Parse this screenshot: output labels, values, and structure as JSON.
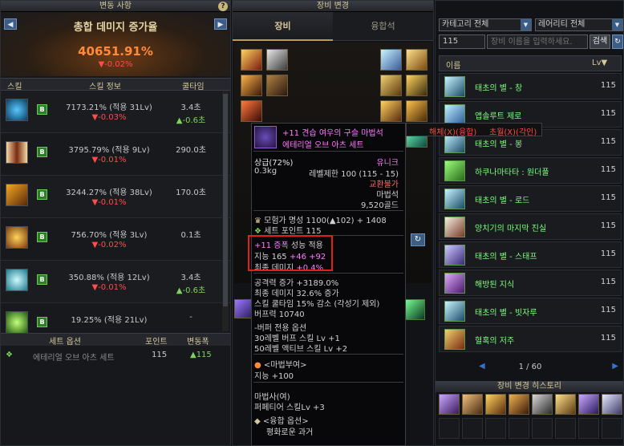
{
  "left": {
    "title": "변동 사항",
    "help": "?",
    "prev": "◀",
    "next": "▶",
    "dmg_title": "총합 데미지 증가율",
    "dmg_value": "40651.91%",
    "dmg_delta": "▼-0.02%",
    "headers": {
      "skill": "스킬",
      "info": "스킬 정보",
      "cooldown": "쿨타임"
    },
    "skills": [
      {
        "badge": "B",
        "info": "7173.21% (적용 31Lv)",
        "delta": "▼-0.03%",
        "cool": "3.4초",
        "cool_delta": "▲-0.6초"
      },
      {
        "badge": "B",
        "info": "3795.79% (적용 9Lv)",
        "delta": "▼-0.01%",
        "cool": "290.0초",
        "cool_delta": ""
      },
      {
        "badge": "B",
        "info": "3244.27% (적용 38Lv)",
        "delta": "▼-0.01%",
        "cool": "170.0초",
        "cool_delta": ""
      },
      {
        "badge": "B",
        "info": "756.70% (적용 3Lv)",
        "delta": "▼-0.02%",
        "cool": "0.1초",
        "cool_delta": ""
      },
      {
        "badge": "B",
        "info": "350.88% (적용 12Lv)",
        "delta": "▼-0.01%",
        "cool": "3.4초",
        "cool_delta": "▲-0.6초"
      },
      {
        "badge": "B",
        "info": "19.25% (적용 21Lv)",
        "delta": "",
        "cool": "-",
        "cool_delta": ""
      }
    ],
    "set_headers": {
      "option": "세트 옵션",
      "point": "포인트",
      "delta": "변동폭"
    },
    "set_row": {
      "name": "에테리얼 오브 아츠 세트",
      "point": "115",
      "delta": "▲115"
    }
  },
  "center": {
    "title": "장비 변경",
    "tab_equip": "장비",
    "tab_fusion": "융합석"
  },
  "tooltip": {
    "name": "+11 견습 여우의 구슬 마법석",
    "set": "에테리얼 오브 아츠 세트",
    "grade": "상급(72%)",
    "rarity": "유니크",
    "weight": "0.3kg",
    "level_limit": "레벨제한 100 (115 - 15)",
    "trade": "교환불가",
    "type": "마법석",
    "price": "9,520골드",
    "fame": "모험가 명성 1100(▲102) + 1408",
    "set_point": "세트 포인트 115",
    "amp_title": "+11 증폭",
    "amp_note": "성능 적용",
    "int": "지능 165",
    "int_add1": "+46",
    "int_add2": "+92",
    "final_dmg": "최종 데미지",
    "final_dmg_val": "+0.4%",
    "stat1": "공격력 증가 +3189.0%",
    "stat2": "최종 데미지 32.6% 증가",
    "stat3": "스킬 쿨타임 15% 감소 (각성기 제외)",
    "stat4": "버프력 10740",
    "buff_title": "-버퍼 전용 옵션",
    "buff1": "30레벨 버프 스킬 Lv +1",
    "buff2": "50레벨 액티브 스킬 Lv +2",
    "enchant_title": "<마법부여>",
    "enchant": "지능 +100",
    "class_title": "마법사(여)",
    "class_skill": "퍼페티어 스킬Lv +3",
    "fusion_title": "<융합 옵션>",
    "fusion": "평화로운 과거"
  },
  "context_menu": {
    "unfuse": "해체(X)(융합)",
    "transcend": "초월(X)(각인)"
  },
  "right": {
    "category": "카테고리 전체",
    "rarity": "레어리티 전체",
    "level": "115",
    "search_placeholder": "장비 이름을 입력하세요.",
    "search_btn": "검색",
    "col_name": "이름",
    "col_lv": "Lv▼",
    "items": [
      {
        "name": "태초의 별 - 창",
        "lv": "115"
      },
      {
        "name": "앱솔루트 제로",
        "lv": "115"
      },
      {
        "name": "태초의 별 - 봉",
        "lv": "115"
      },
      {
        "name": "하쿠나마타타 : 원더풀",
        "lv": "115"
      },
      {
        "name": "태초의 별 - 로드",
        "lv": "115"
      },
      {
        "name": "양치기의 마지막 진실",
        "lv": "115"
      },
      {
        "name": "태초의 별 - 스태프",
        "lv": "115"
      },
      {
        "name": "해방된 지식",
        "lv": "115"
      },
      {
        "name": "태초의 별 - 빗자루",
        "lv": "115"
      },
      {
        "name": "혈혹의 저주",
        "lv": "115"
      }
    ],
    "page": "1 / 60",
    "history_title": "장비 변경 히스토리"
  }
}
